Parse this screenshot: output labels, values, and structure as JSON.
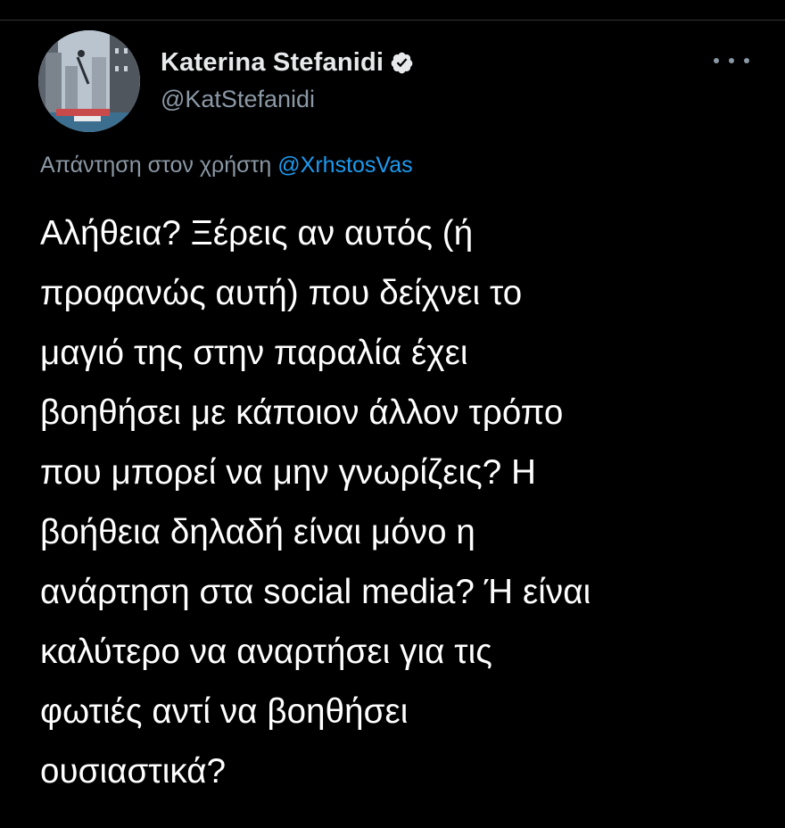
{
  "author": {
    "display_name": "Katerina Stefanidi",
    "handle": "@KatStefanidi",
    "verified": true
  },
  "reply_context": {
    "prefix": "Απάντηση στον χρήστη ",
    "mention": "@XrhstosVas"
  },
  "tweet": {
    "lines": [
      "Αλήθεια? Ξέρεις αν αυτός (ή",
      "προφανώς αυτή) που δείχνει το",
      "μαγιό της στην παραλία έχει",
      "βοηθήσει με κάποιον άλλον τρόπο",
      "που μπορεί να μην γνωρίζεις? Η",
      "βοήθεια δηλαδή είναι μόνο η",
      "ανάρτηση στα social media? Ή είναι",
      "καλύτερο να αναρτήσει για τις",
      "φωτιές αντί να βοηθήσει",
      "ουσιαστικά?"
    ]
  },
  "icons": {
    "verified": "verified-badge-icon",
    "more": "more-options-icon"
  },
  "colors": {
    "background": "#000000",
    "text_primary": "#ffffff",
    "text_secondary": "#8b98a5",
    "accent": "#1d9bf0"
  }
}
